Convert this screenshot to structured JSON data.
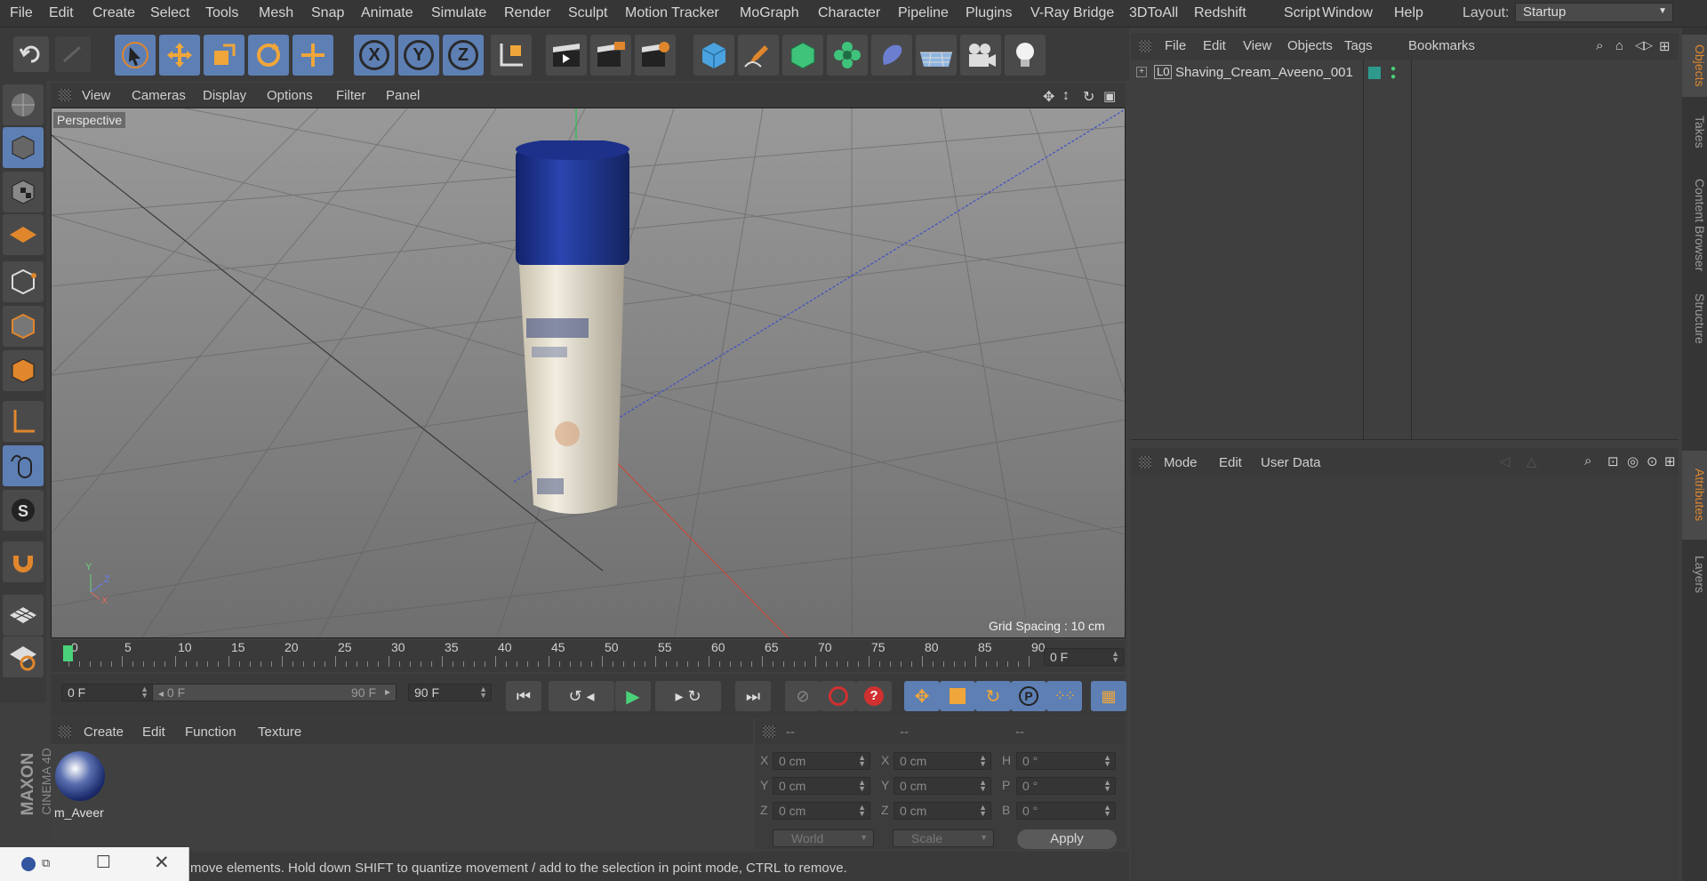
{
  "menubar": {
    "items": [
      "File",
      "Edit",
      "Create",
      "Select",
      "Tools",
      "Mesh",
      "Snap",
      "Animate",
      "Simulate",
      "Render",
      "Sculpt",
      "Motion Tracker",
      "MoGraph",
      "Character",
      "Pipeline",
      "Plugins",
      "V-Ray Bridge",
      "3DToAll",
      "Redshift",
      "Script",
      "Window",
      "Help"
    ],
    "layout_label": "Layout:",
    "layout_value": "Startup"
  },
  "toolbar": {
    "axis_x": "X",
    "axis_y": "Y",
    "axis_z": "Z"
  },
  "viewport": {
    "menu": [
      "View",
      "Cameras",
      "Display",
      "Options",
      "Filter",
      "Panel"
    ],
    "label": "Perspective",
    "grid_spacing": "Grid Spacing : 10 cm",
    "axis_y": "Y",
    "axis_z": "Z",
    "axis_x": "X"
  },
  "timeline": {
    "ticks": [
      "0",
      "5",
      "10",
      "15",
      "20",
      "25",
      "30",
      "35",
      "40",
      "45",
      "50",
      "55",
      "60",
      "65",
      "70",
      "75",
      "80",
      "85",
      "90"
    ],
    "current_frame": "0 F",
    "start_field": "0 F",
    "range_start": "0 F",
    "range_end": "90 F",
    "end_field": "90 F"
  },
  "materials": {
    "menu": [
      "Create",
      "Edit",
      "Function",
      "Texture"
    ],
    "material_name": "m_Aveer"
  },
  "coords": {
    "headers": [
      "--",
      "--",
      "--"
    ],
    "rows": [
      {
        "l1": "X",
        "v1": "0 cm",
        "l2": "X",
        "v2": "0 cm",
        "l3": "H",
        "v3": "0 °"
      },
      {
        "l1": "Y",
        "v1": "0 cm",
        "l2": "Y",
        "v2": "0 cm",
        "l3": "P",
        "v3": "0 °"
      },
      {
        "l1": "Z",
        "v1": "0 cm",
        "l2": "Z",
        "v2": "0 cm",
        "l3": "B",
        "v3": "0 °"
      }
    ],
    "world": "World",
    "scale": "Scale",
    "apply": "Apply"
  },
  "objects": {
    "menu": [
      "File",
      "Edit",
      "View",
      "Objects",
      "Tags",
      "Bookmarks"
    ],
    "object_name": "Shaving_Cream_Aveeno_001",
    "object_prefix": "L0"
  },
  "attributes": {
    "menu": [
      "Mode",
      "Edit",
      "User Data"
    ]
  },
  "right_tabs_top": [
    "Objects",
    "Takes",
    "Content Browser",
    "Structure"
  ],
  "right_tabs_bottom": [
    "Attributes",
    "Layers"
  ],
  "brand": {
    "line1": "MAXON",
    "line2": "CINEMA 4D"
  },
  "statusbar": {
    "text": "move elements. Hold down SHIFT to quantize movement / add to the selection in point mode, CTRL to remove."
  },
  "colors": {
    "accent_blue": "#5d7fb4",
    "selection_orange": "#e0862c",
    "frame_green": "#4ad27a"
  }
}
